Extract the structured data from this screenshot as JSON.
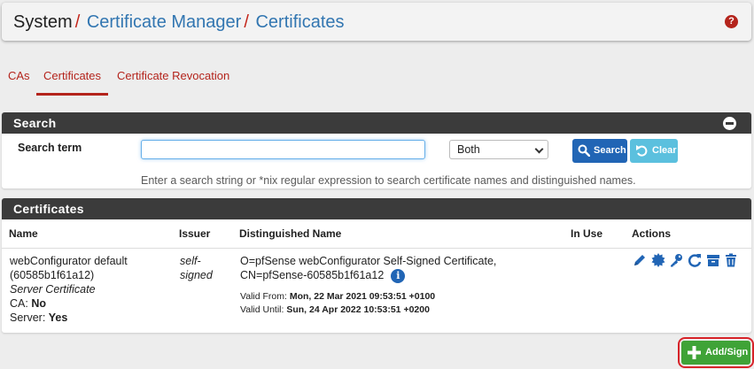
{
  "breadcrumb": {
    "root": "System",
    "separator": "/",
    "links": [
      "Certificate Manager",
      "Certificates"
    ]
  },
  "help_icon": "?",
  "tabs": [
    {
      "label": "CAs",
      "active": false
    },
    {
      "label": "Certificates",
      "active": true
    },
    {
      "label": "Certificate Revocation",
      "active": false
    }
  ],
  "search": {
    "panel_title": "Search",
    "label": "Search term",
    "input_value": "",
    "select_value": "Both",
    "search_button": "Search",
    "clear_button": "Clear",
    "hint": "Enter a search string or *nix regular expression to search certificate names and distinguished names."
  },
  "certificates": {
    "panel_title": "Certificates",
    "columns": [
      "Name",
      "Issuer",
      "Distinguished Name",
      "In Use",
      "Actions"
    ],
    "rows": [
      {
        "name_line1": "webConfigurator default",
        "name_line2": "(60585b1f61a12)",
        "type": "Server Certificate",
        "ca_label": "CA:",
        "ca_value": "No",
        "server_label": "Server:",
        "server_value": "Yes",
        "issuer_line1": "self-",
        "issuer_line2": "signed",
        "dn_line1": "O=pfSense webConfigurator Self-Signed Certificate,",
        "dn_line2": "CN=pfSense-60585b1f61a12",
        "info_icon": "i",
        "valid_from_label": "Valid From:",
        "valid_from": "Mon, 22 Mar 2021 09:53:51 +0100",
        "valid_until_label": "Valid Until:",
        "valid_until": "Sun, 24 Apr 2022 10:53:51 +0200",
        "in_use": ""
      }
    ],
    "action_icons": [
      "pencil-icon",
      "certificate-icon",
      "key-icon",
      "renew-icon",
      "archive-icon",
      "trash-icon"
    ]
  },
  "add_button": "Add/Sign",
  "colors": {
    "accent_red": "#b4241c",
    "link_blue": "#3276b1",
    "primary_blue": "#2165b5",
    "info_cyan": "#5bc0de",
    "success_green": "#3fa337",
    "panel_header": "#3b3b3b"
  }
}
